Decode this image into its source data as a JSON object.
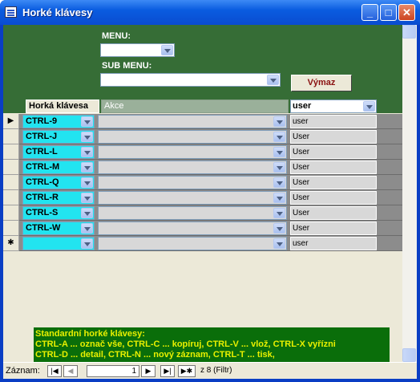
{
  "window": {
    "title": "Horké klávesy",
    "min": "_",
    "max": "□",
    "close": "✕"
  },
  "header": {
    "menu_label": "MENU:",
    "submenu_label": "SUB MENU:",
    "clear_button": "Výmaz"
  },
  "columns": {
    "hotkey": "Horká klávesa",
    "action": "Akce",
    "user": "user"
  },
  "rows": [
    {
      "selector": "▶",
      "hotkey": "CTRL-9",
      "user": "user"
    },
    {
      "selector": "",
      "hotkey": "CTRL-J",
      "user": "User"
    },
    {
      "selector": "",
      "hotkey": "CTRL-L",
      "user": "User"
    },
    {
      "selector": "",
      "hotkey": "CTRL-M",
      "user": "User"
    },
    {
      "selector": "",
      "hotkey": "CTRL-Q",
      "user": "User"
    },
    {
      "selector": "",
      "hotkey": "CTRL-R",
      "user": "User"
    },
    {
      "selector": "",
      "hotkey": "CTRL-S",
      "user": "User"
    },
    {
      "selector": "",
      "hotkey": "CTRL-W",
      "user": "User"
    },
    {
      "selector": "✱",
      "hotkey": "",
      "user": "user"
    }
  ],
  "footer": {
    "line1": "Standardní horké klávesy:",
    "line2": "CTRL-A ... označ vše, CTRL-C ... kopíruj, CTRL-V ... vlož, CTRL-X vyřízni",
    "line3": "CTRL-D ... detail, CTRL-N ... nový záznam, CTRL-T ... tisk,"
  },
  "navigation": {
    "label": "Záznam:",
    "first": "|◀",
    "prev": "◀",
    "current": "1",
    "next": "▶",
    "last": "▶|",
    "new": "▶✱",
    "total": "z  8 (Filtr)"
  }
}
